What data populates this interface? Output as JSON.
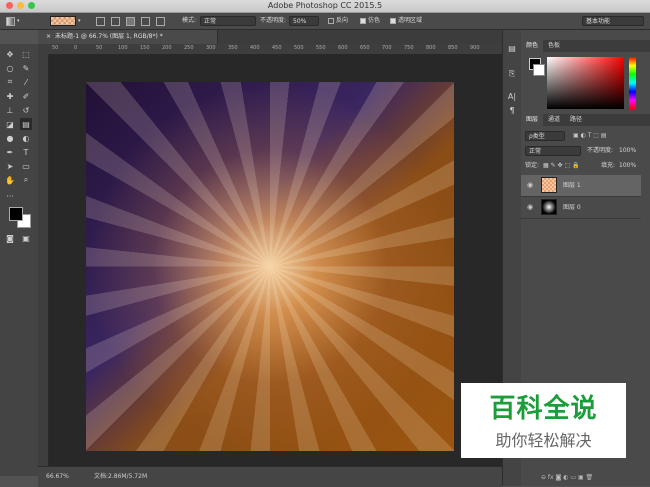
{
  "window": {
    "title": "Adobe Photoshop CC 2015.5"
  },
  "options": {
    "mode_label": "模式:",
    "mode_value": "正常",
    "opacity_label": "不透明度:",
    "opacity_value": "50%",
    "reverse": "反向",
    "dither": "仿色",
    "transparency": "透明区域",
    "workspace": "基本功能"
  },
  "document": {
    "tab_title": "未标题-1 @ 66.7% (图层 1, RGB/8*) *"
  },
  "ruler": {
    "ticks": [
      "50",
      "0",
      "50",
      "100",
      "150",
      "200",
      "250",
      "300",
      "350",
      "400",
      "450",
      "500",
      "550",
      "600",
      "650",
      "700",
      "750",
      "800",
      "850",
      "900"
    ]
  },
  "status": {
    "zoom": "66.67%",
    "doc": "文档:2.86M/5.72M"
  },
  "color_panel": {
    "tab_color": "颜色",
    "tab_swatch": "色板"
  },
  "layers_panel": {
    "tab_layers": "图层",
    "tab_channels": "通道",
    "tab_paths": "路径",
    "kind": "ρ类型",
    "blend": "正常",
    "opacity_label": "不透明度:",
    "opacity_value": "100%",
    "lock_label": "锁定:",
    "fill_label": "填充:",
    "fill_value": "100%",
    "layers": [
      {
        "name": "图层 1"
      },
      {
        "name": "图层 0"
      }
    ]
  },
  "watermark": {
    "line1": "百科全说",
    "line2": "助你轻松解决"
  }
}
